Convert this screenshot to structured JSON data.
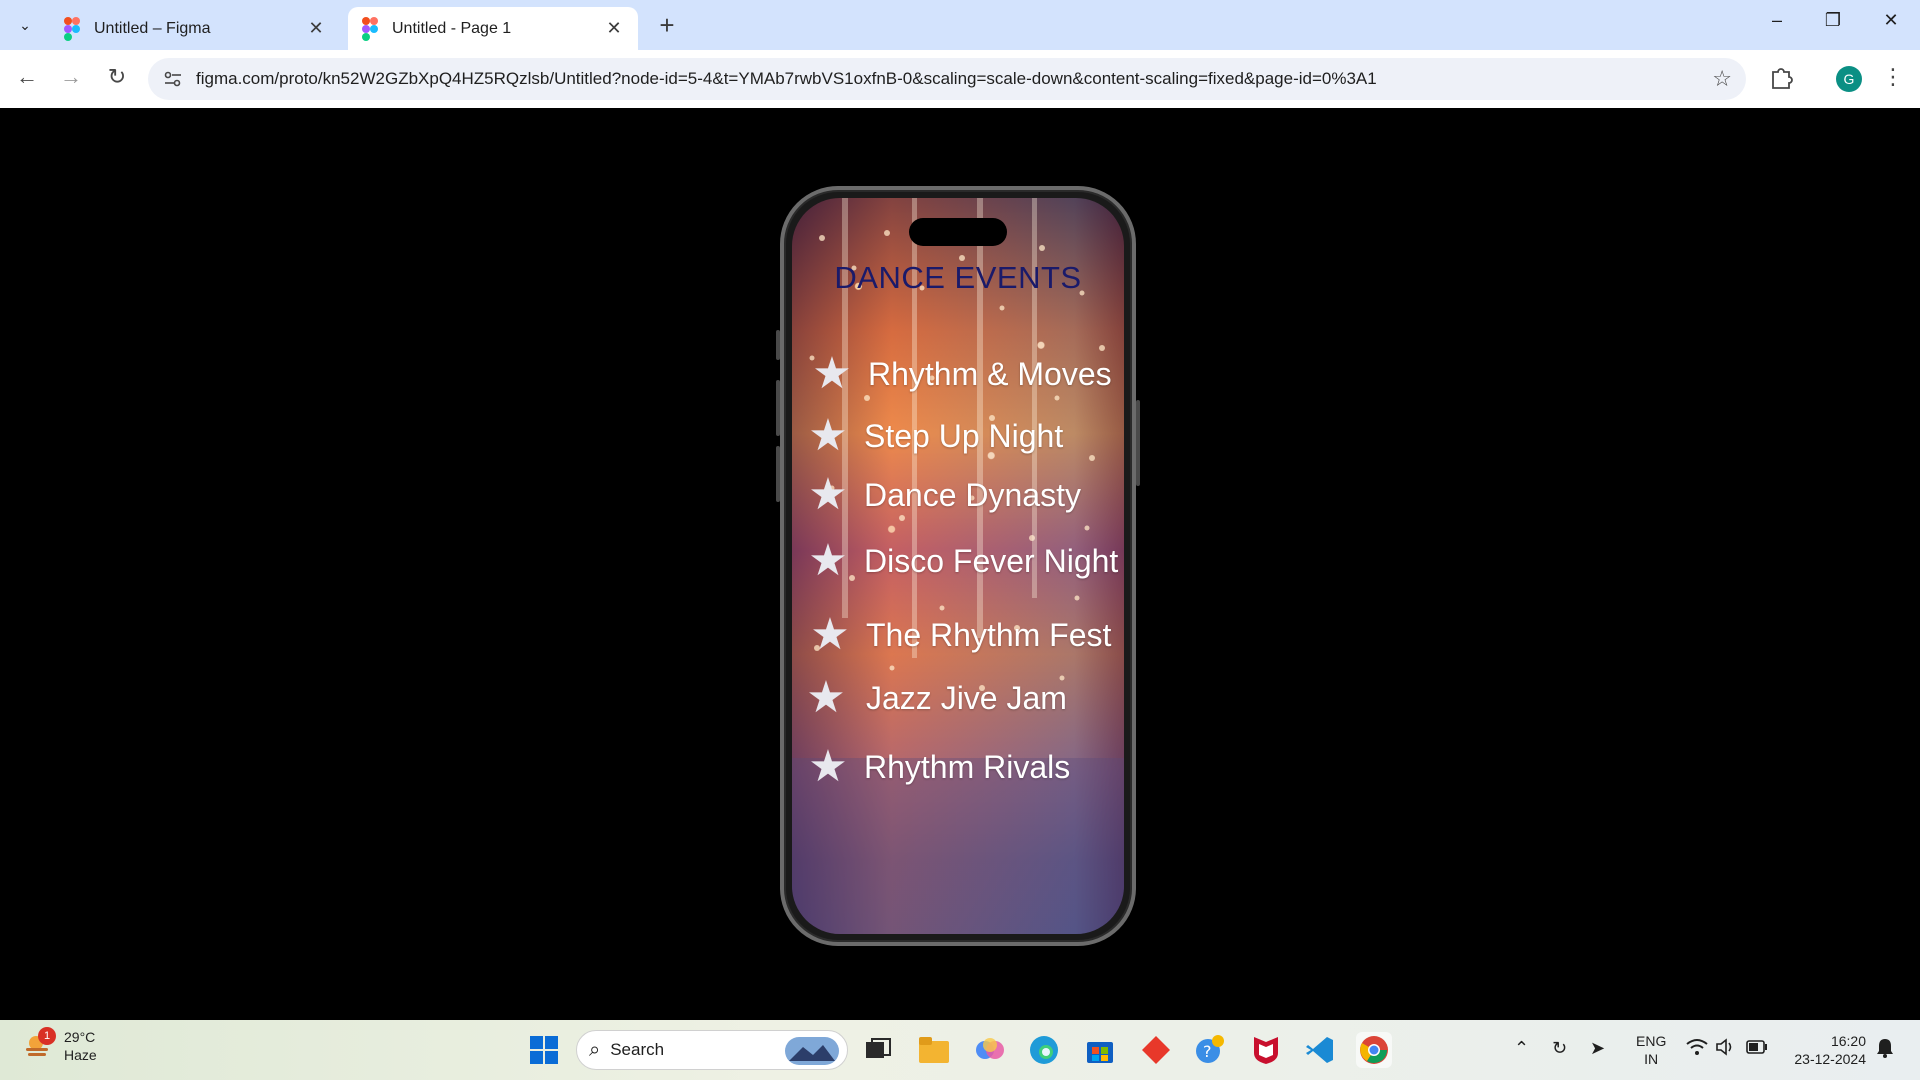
{
  "browser": {
    "tabs": [
      {
        "title": "Untitled – Figma",
        "active": false
      },
      {
        "title": "Untitled - Page 1",
        "active": true
      }
    ],
    "url": "figma.com/proto/kn52W2GZbXpQ4HZ5RQzlsb/Untitled?node-id=5-4&t=YMAb7rwbVS1oxfnB-0&scaling=scale-down&content-scaling=fixed&page-id=0%3A1",
    "profile_initial": "G"
  },
  "prototype": {
    "title": "DANCE EVENTS",
    "events": [
      {
        "label": "Rhythm & Moves"
      },
      {
        "label": "Step Up Night"
      },
      {
        "label": "Dance Dynasty"
      },
      {
        "label": "Disco Fever Night"
      },
      {
        "label": "The Rhythm Fest"
      },
      {
        "label": "Jazz Jive Jam"
      },
      {
        "label": "Rhythm Rivals"
      }
    ]
  },
  "taskbar": {
    "weather_temp": "29°C",
    "weather_desc": "Haze",
    "weather_badge": "1",
    "search_label": "Search",
    "lang_line1": "ENG",
    "lang_line2": "IN",
    "time": "16:20",
    "date": "23-12-2024"
  },
  "colors": {
    "tabbar_bg": "#d3e3fd",
    "title_color": "#1a1a6a",
    "profile_bg": "#0b8f84"
  }
}
